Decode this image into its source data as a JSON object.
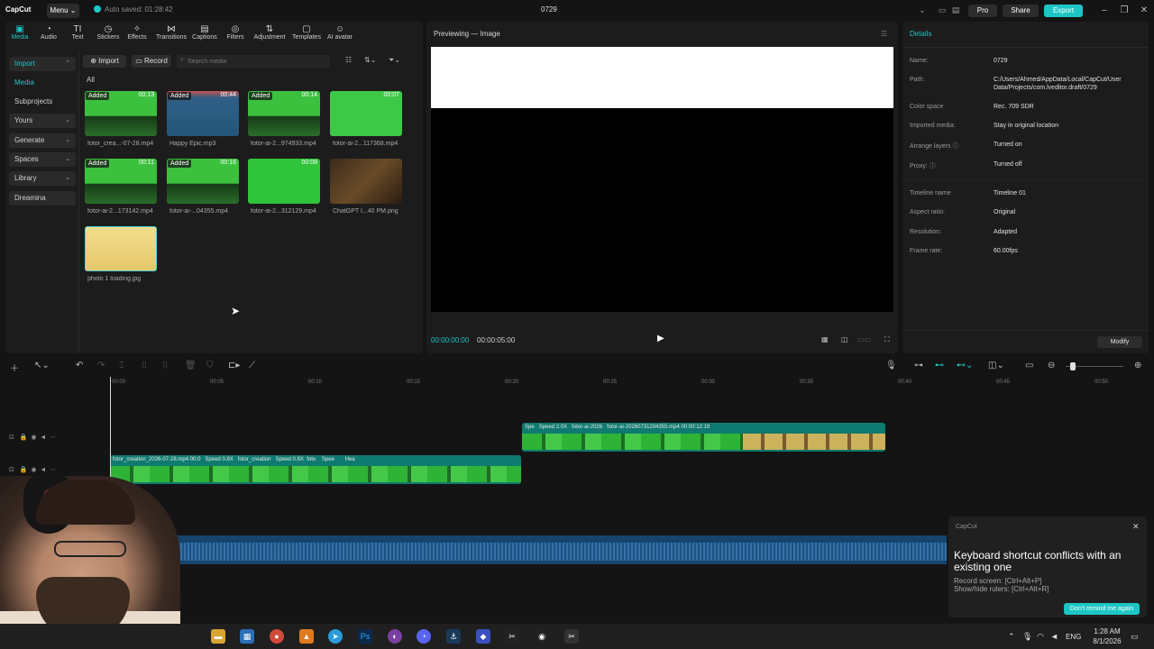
{
  "titlebar": {
    "logo": "CapCut",
    "menu_label": "Menu ⌄",
    "autosave": "Auto saved: 01:28:42",
    "project_title": "0729",
    "pro_label": "Pro",
    "share_label": "Share",
    "export_label": "Export"
  },
  "toolbar_tabs": [
    {
      "label": "Media",
      "icon": "media-icon"
    },
    {
      "label": "Audio",
      "icon": "audio-icon"
    },
    {
      "label": "Text",
      "icon": "text-icon"
    },
    {
      "label": "Stickers",
      "icon": "stickers-icon"
    },
    {
      "label": "Effects",
      "icon": "effects-icon"
    },
    {
      "label": "Transitions",
      "icon": "transitions-icon"
    },
    {
      "label": "Captions",
      "icon": "captions-icon"
    },
    {
      "label": "Filters",
      "icon": "filters-icon"
    },
    {
      "label": "Adjustment",
      "icon": "adjustment-icon"
    },
    {
      "label": "Templates",
      "icon": "templates-icon"
    },
    {
      "label": "AI avatar",
      "icon": "ai-avatar-icon"
    }
  ],
  "side_nav": [
    {
      "label": "Import",
      "active": true
    },
    {
      "label": "Media",
      "active": true
    },
    {
      "label": "Subprojects"
    },
    {
      "label": "Yours"
    },
    {
      "label": "Generate"
    },
    {
      "label": "Spaces"
    },
    {
      "label": "Library"
    },
    {
      "label": "Dreamina"
    }
  ],
  "media_toolbar": {
    "import_label": "Import",
    "record_label": "Record",
    "search_placeholder": "Search media",
    "filter_all": "All"
  },
  "media_items": [
    {
      "name": "fotor_crea...-07-28.mp4",
      "badge": "Added",
      "duration": "00:13"
    },
    {
      "name": "Happy Epic.mp3",
      "badge": "Added",
      "duration": "00:44"
    },
    {
      "name": "fotor-ai-2...974933.mp4",
      "badge": "Added",
      "duration": "00:14"
    },
    {
      "name": "fotor-ai-2...117368.mp4",
      "badge": "",
      "duration": "00:07"
    },
    {
      "name": "fotor-ai-2...173142.mp4",
      "badge": "Added",
      "duration": "00:11"
    },
    {
      "name": "fotor-ai-...04355.mp4",
      "badge": "Added",
      "duration": "00:16"
    },
    {
      "name": "fotor-ai-2...312129.mp4",
      "badge": "",
      "duration": "00:08"
    },
    {
      "name": "ChatGPT I...40 PM.png",
      "badge": "",
      "duration": ""
    },
    {
      "name": "photo 1 loading.jpg",
      "badge": "",
      "duration": ""
    }
  ],
  "preview": {
    "title": "Previewing — Image",
    "time_current": "00:00:00:00",
    "time_total": "00:00:05:00"
  },
  "details": {
    "title": "Details",
    "rows": [
      {
        "label": "Name:",
        "value": "0729"
      },
      {
        "label": "Path:",
        "value": "C:/Users/Ahmed/AppData/Local/CapCut/User Data/Projects/com.lveditor.draft/0729"
      },
      {
        "label": "Color space",
        "value": "Rec. 709 SDR"
      },
      {
        "label": "Imported media:",
        "value": "Stay in original location"
      },
      {
        "label": "Arrange layers",
        "value": "Turned on"
      },
      {
        "label": "Proxy:",
        "value": "Turned off"
      },
      {
        "label": "Timeline name",
        "value": "Timeline 01"
      },
      {
        "label": "Aspect ratio:",
        "value": "Original"
      },
      {
        "label": "Resolution:",
        "value": "Adapted"
      },
      {
        "label": "Frame rate:",
        "value": "60.00fps"
      }
    ],
    "modify_label": "Modify"
  },
  "timeline": {
    "ticks": [
      "00:00",
      "00:05",
      "00:10",
      "00:15",
      "00:20",
      "00:25",
      "00:30",
      "00:35",
      "00:40",
      "00:45",
      "00:50"
    ],
    "upper_clip_labels": [
      "Spe",
      "Speed 2.0X",
      "fotor-ai-2026",
      "fotor-ai-20260731204355.mp4  00:00:12:19"
    ],
    "lower_clip_labels": [
      "fotor_creation_2026-07-28.mp4  00:0",
      "Speed 0.8X",
      "fotor_creation",
      "Speed 0.8X",
      "foto",
      "Spee",
      "Hea"
    ]
  },
  "toast": {
    "app": "CapCut",
    "title": "Keyboard shortcut conflicts with an existing one",
    "line1": "Record screen: [Ctrl+Alt+P]",
    "line2": "Show/hide rulers: [Ctrl+Alt+R]",
    "button": "Don't remind me again"
  },
  "taskbar": {
    "lang": "ENG",
    "time": "1:28 AM",
    "date": "8/1/2026"
  },
  "colors": {
    "accent": "#1dc6c4",
    "clip_teal": "#0f7a6f",
    "audio_blue": "#16446c"
  }
}
